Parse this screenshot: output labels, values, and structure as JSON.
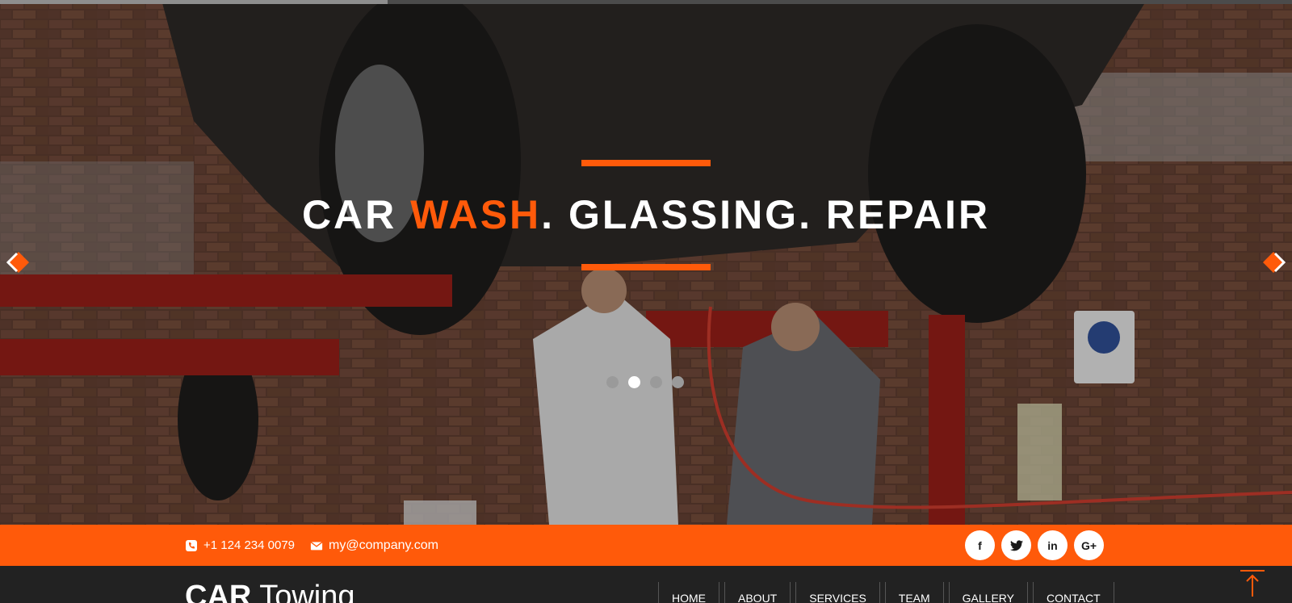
{
  "hero": {
    "title_part1": "CAR ",
    "title_accent": "WASH",
    "title_part2": ". GLASSING. REPAIR",
    "slide_progress": 0.3,
    "slides_count": 4,
    "active_slide": 2
  },
  "contact": {
    "phone": "+1 124 234 0079",
    "email": "my@company.com"
  },
  "social": {
    "facebook": "f",
    "twitter": "t",
    "linkedin": "in",
    "googleplus": "G+"
  },
  "logo": {
    "bold": "CAR",
    "light": " Towing"
  },
  "nav": {
    "items": [
      "HOME",
      "ABOUT",
      "SERVICES",
      "TEAM",
      "GALLERY",
      "CONTACT"
    ]
  },
  "colors": {
    "accent": "#ff5a0a",
    "dark": "#222222",
    "white": "#ffffff"
  },
  "icons": {
    "prev": "chevron-left-icon",
    "next": "chevron-right-icon",
    "phone": "phone-icon",
    "email": "envelope-icon",
    "back_to_top": "arrow-up-icon"
  }
}
